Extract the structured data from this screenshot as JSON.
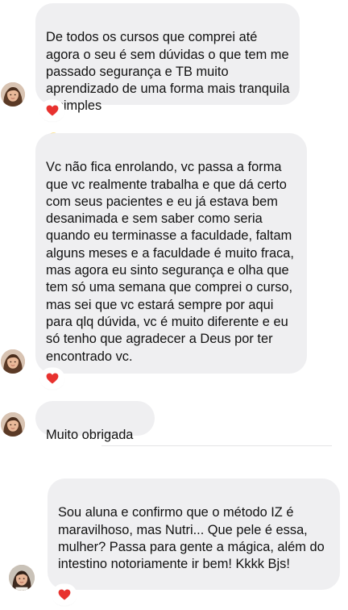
{
  "messages": [
    {
      "text": "De todos os cursos que comprei até agora o seu é sem dúvidas o que tem me passado segurança e TB muito aprendizado de uma forma mais tranquila e simples",
      "trailing_emoji": "grinning-face",
      "reaction": "heart"
    },
    {
      "text": "Vc não fica enrolando, vc passa a forma que vc realmente trabalha e que dá certo com seus pacientes e eu já estava bem desanimada e sem saber como seria quando eu terminasse a faculdade, faltam alguns meses e a faculdade é muito fraca, mas agora eu sinto segurança e olha que tem só uma semana que comprei o curso, mas sei que vc estará sempre por aqui para qlq dúvida, vc é muito diferente e eu só tenho que agradecer a Deus por ter encontrado vc.",
      "reaction": "heart"
    },
    {
      "text": "Muito obrigada"
    },
    {
      "text": "Sou aluna e confirmo que o método IZ é maravilhoso, mas Nutri... Que pele é essa, mulher? Passa para gente a mágica, além do intestino notoriamente ir bem! Kkkk Bjs!",
      "reaction": "heart"
    }
  ],
  "colors": {
    "bubble": "#efeff1",
    "text": "#111111",
    "heart": "#e8322f",
    "divider": "#e4e4e6"
  }
}
